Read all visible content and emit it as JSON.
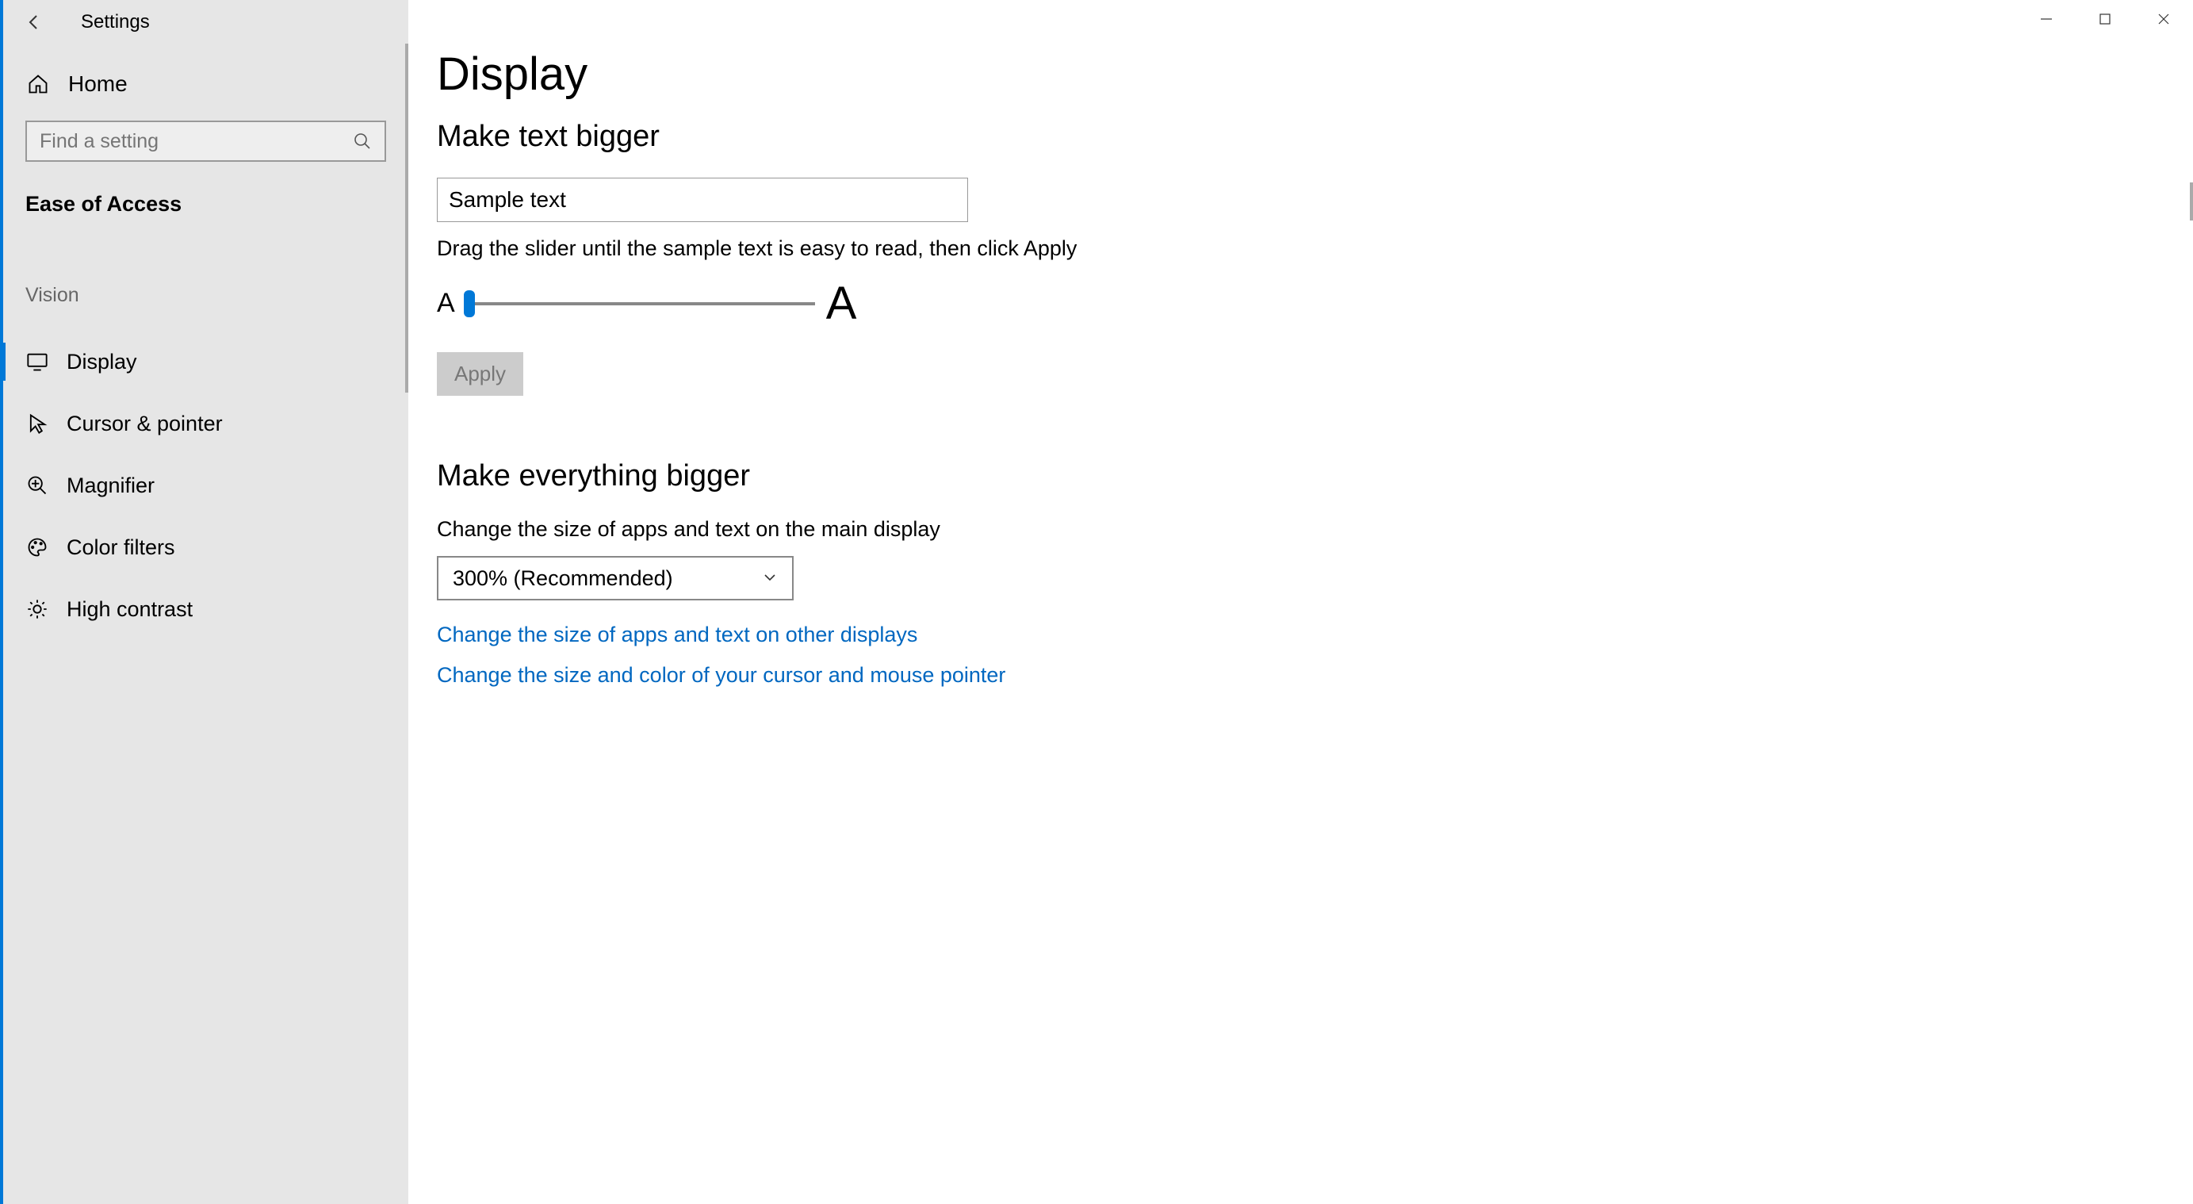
{
  "window": {
    "title": "Settings"
  },
  "sidebar": {
    "home_label": "Home",
    "search_placeholder": "Find a setting",
    "category_title": "Ease of Access",
    "group_label": "Vision",
    "items": [
      {
        "label": "Display",
        "icon": "monitor-icon",
        "selected": true
      },
      {
        "label": "Cursor & pointer",
        "icon": "cursor-icon",
        "selected": false
      },
      {
        "label": "Magnifier",
        "icon": "magnifier-icon",
        "selected": false
      },
      {
        "label": "Color filters",
        "icon": "palette-icon",
        "selected": false
      },
      {
        "label": "High contrast",
        "icon": "brightness-icon",
        "selected": false
      }
    ]
  },
  "main": {
    "page_title": "Display",
    "section1": {
      "heading": "Make text bigger",
      "sample_text": "Sample text",
      "slider_help": "Drag the slider until the sample text is easy to read, then click Apply",
      "slider_small_label": "A",
      "slider_big_label": "A",
      "apply_label": "Apply"
    },
    "section2": {
      "heading": "Make everything bigger",
      "desc": "Change the size of apps and text on the main display",
      "combo_value": "300% (Recommended)",
      "link1": "Change the size of apps and text on other displays",
      "link2": "Change the size and color of your cursor and mouse pointer"
    }
  }
}
